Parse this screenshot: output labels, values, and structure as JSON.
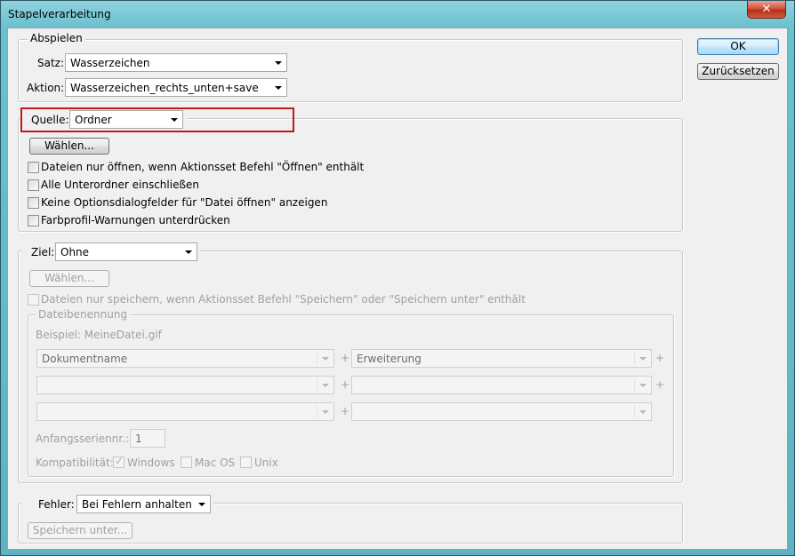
{
  "window": {
    "title": "Stapelverarbeitung",
    "close_glyph": "✕"
  },
  "buttons": {
    "ok": "OK",
    "reset": "Zurücksetzen"
  },
  "play": {
    "legend": "Abspielen",
    "set_label": "Satz:",
    "set_value": "Wasserzeichen",
    "action_label": "Aktion:",
    "action_value": "Wasserzeichen_rechts_unten+save"
  },
  "source": {
    "label": "Quelle:",
    "value": "Ordner",
    "choose": "Wählen...",
    "options": [
      "Dateien nur öffnen, wenn Aktionsset Befehl \"Öffnen\" enthält",
      "Alle Unterordner einschließen",
      "Keine Optionsdialogfelder für \"Datei öffnen\" anzeigen",
      "Farbprofil-Warnungen unterdrücken"
    ]
  },
  "target": {
    "label": "Ziel:",
    "value": "Ohne",
    "choose": "Wählen...",
    "save_only": "Dateien nur speichern, wenn Aktionsset Befehl \"Speichern\" oder \"Speichern unter\" enthält",
    "naming": {
      "legend": "Dateibenennung",
      "example": "Beispiel: MeineDatei.gif",
      "row1_left": "Dokumentname",
      "row1_right": "Erweiterung",
      "plus": "+",
      "serial_label": "Anfangsseriennr.:",
      "serial_value": "1",
      "compat_label": "Kompatibilität:",
      "windows": "Windows",
      "mac": "Mac OS",
      "unix": "Unix"
    }
  },
  "errors": {
    "label": "Fehler:",
    "value": "Bei Fehlern anhalten",
    "save_as": "Speichern unter..."
  }
}
